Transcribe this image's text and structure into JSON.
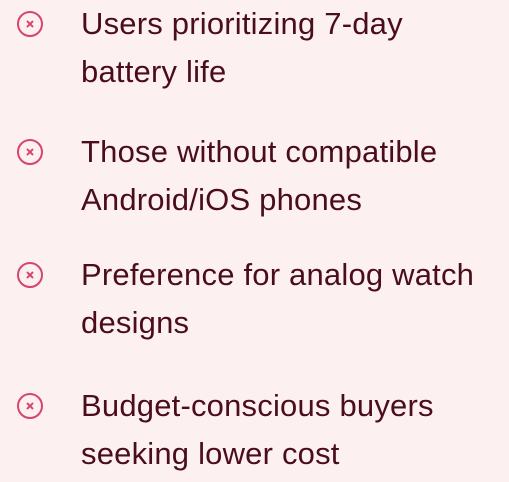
{
  "limitations": {
    "icon": "circle-x-icon",
    "icon_color": "#d6456b",
    "text_color": "#4a0d1f",
    "background": "#fdf0f1",
    "items": [
      {
        "label": "Users prioritizing 7-day battery life"
      },
      {
        "label": "Those without compatible Android/iOS phones"
      },
      {
        "label": "Preference for analog watch designs"
      },
      {
        "label": "Budget-conscious buyers seeking lower cost"
      }
    ]
  }
}
